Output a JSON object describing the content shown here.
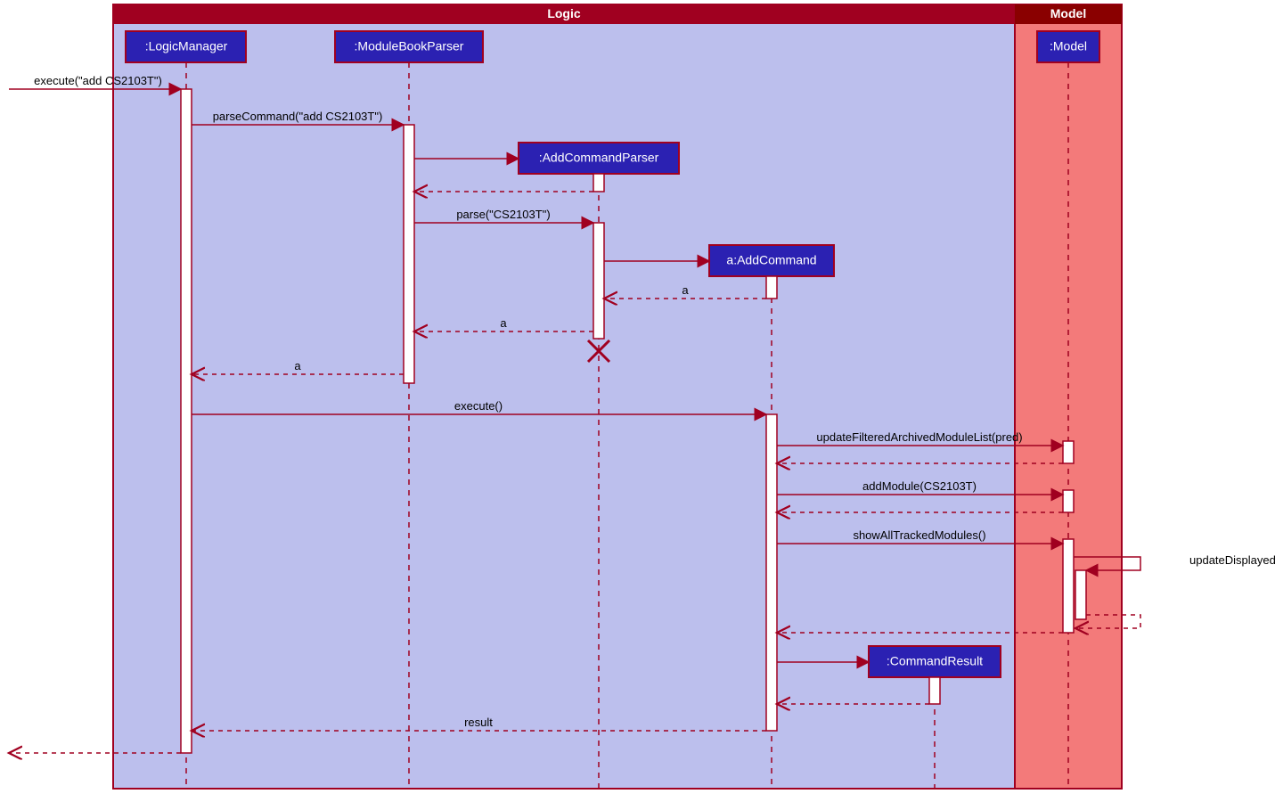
{
  "frames": {
    "logic": "Logic",
    "model": "Model"
  },
  "lifelines": {
    "logicManager": ":LogicManager",
    "moduleBookParser": ":ModuleBookParser",
    "addCommandParser": ":AddCommandParser",
    "addCommand": "a:AddCommand",
    "commandResult": ":CommandResult",
    "model": ":Model"
  },
  "messages": {
    "execute1": "execute(\"add CS2103T\")",
    "parseCommand": "parseCommand(\"add CS2103T\")",
    "parse": "parse(\"CS2103T\")",
    "ret_a1": "a",
    "ret_a2": "a",
    "ret_a3": "a",
    "execute2": "execute()",
    "updateFiltered": "updateFilteredArchivedModuleList(pred)",
    "addModule": "addModule(CS2103T)",
    "showAll": "showAllTrackedModules()",
    "updateDisplayed": "updateDisplayedList()",
    "result": "result"
  }
}
